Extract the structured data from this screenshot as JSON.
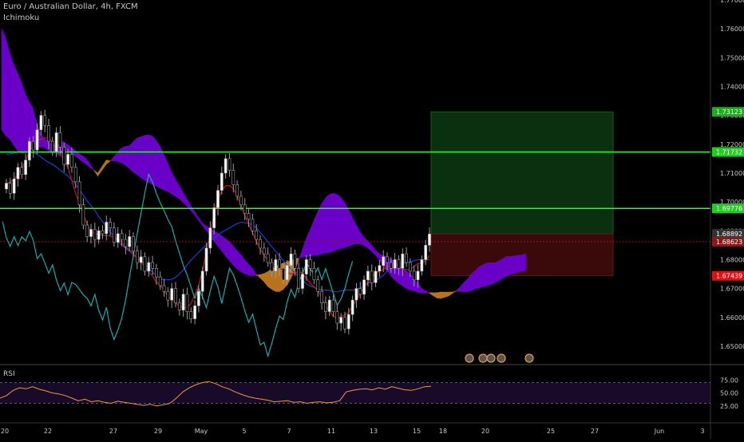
{
  "header": {
    "symbol_title": "Euro / Australian Dollar, 4h, FXCM",
    "indicator": "Ichimoku"
  },
  "rsi_panel": {
    "label": "RSI",
    "ticks": [
      "75.00",
      "50.00",
      "25.00"
    ],
    "upper": 70,
    "lower": 30
  },
  "colors": {
    "background": "#000000",
    "bull_candle": "#ffffff",
    "bear_candle": "#000000",
    "candle_outline": "#9c9c9c",
    "cloud_bull": "#6a00c8",
    "cloud_bear": "#b8731f",
    "tenkan": "#cc1010",
    "kijun": "#1a3fd1",
    "chikou": "#1ea8a8",
    "horizontal_level": "#22ff22",
    "current_price_line": "#8a1a1a",
    "rsi_line": "#e89a3c",
    "rsi_band": "#1a0a2a",
    "target_zone": "#0b3010",
    "stop_zone": "#3a0a0a",
    "axis_text": "#c8c8c8"
  },
  "chart_data": {
    "type": "candlestick",
    "title": "Euro / Australian Dollar, 4h, FXCM",
    "indicator": "Ichimoku",
    "ylim": [
      1.645,
      1.77
    ],
    "y_ticks": [
      "1.77000",
      "1.76000",
      "1.75000",
      "1.74000",
      "1.73000",
      "1.72000",
      "1.71000",
      "1.70000",
      "1.69000",
      "1.68000",
      "1.67000",
      "1.66000",
      "1.65000"
    ],
    "x_ticks": [
      "20",
      "22",
      "27",
      "29",
      "May",
      "5",
      "7",
      "11",
      "13",
      "15",
      "18",
      "20",
      "25",
      "27",
      "Jun",
      "3"
    ],
    "price_labels": [
      {
        "text": "1.73123",
        "value": 1.73123,
        "color": "#22aa22"
      },
      {
        "text": "1.71732",
        "value": 1.71732,
        "color": "#22cc22"
      },
      {
        "text": "1.69776",
        "value": 1.69776,
        "color": "#22cc22"
      },
      {
        "text": "1.68892",
        "value": 1.68892,
        "color": "#333333"
      },
      {
        "text": "1.68623",
        "value": 1.68623,
        "color": "#8a1a1a"
      },
      {
        "text": "1.67439",
        "value": 1.67439,
        "color": "#dd1111"
      }
    ],
    "horizontal_levels": [
      1.71732,
      1.69776
    ],
    "current_price": 1.68623,
    "position": {
      "entry": 1.68892,
      "target": 1.73123,
      "stop": 1.67439
    },
    "candles_close": [
      1.7065,
      1.703,
      1.708,
      1.712,
      1.7095,
      1.7145,
      1.721,
      1.718,
      1.725,
      1.73,
      1.7265,
      1.721,
      1.7175,
      1.724,
      1.719,
      1.713,
      1.7165,
      1.712,
      1.707,
      1.699,
      1.692,
      1.688,
      1.6905,
      1.687,
      1.69,
      1.689,
      1.693,
      1.691,
      1.686,
      1.689,
      1.687,
      1.6845,
      1.688,
      1.683,
      1.679,
      1.681,
      1.676,
      1.679,
      1.677,
      1.674,
      1.671,
      1.669,
      1.666,
      1.67,
      1.665,
      1.6625,
      1.668,
      1.662,
      1.6595,
      1.664,
      1.669,
      1.676,
      1.684,
      1.691,
      1.698,
      1.704,
      1.71,
      1.715,
      1.711,
      1.706,
      1.702,
      1.699,
      1.696,
      1.694,
      1.69,
      1.687,
      1.684,
      1.682,
      1.679,
      1.676,
      1.68,
      1.677,
      1.673,
      1.678,
      1.682,
      1.677,
      1.67,
      1.675,
      1.68,
      1.677,
      1.673,
      1.669,
      1.665,
      1.662,
      1.666,
      1.662,
      1.658,
      1.66,
      1.656,
      1.661,
      1.666,
      1.67,
      1.668,
      1.673,
      1.676,
      1.672,
      1.676,
      1.678,
      1.681,
      1.679,
      1.677,
      1.68,
      1.677,
      1.682,
      1.679,
      1.676,
      1.673,
      1.676,
      1.68,
      1.685,
      1.6889
    ],
    "rsi": [
      40,
      45,
      55,
      60,
      58,
      62,
      57,
      54,
      50,
      48,
      45,
      40,
      35,
      38,
      33,
      35,
      32,
      30,
      34,
      32,
      30,
      28,
      26,
      28,
      25,
      27,
      30,
      40,
      52,
      60,
      66,
      70,
      72,
      68,
      62,
      58,
      52,
      47,
      43,
      40,
      38,
      36,
      33,
      34,
      35,
      32,
      33,
      30,
      32,
      33,
      31,
      32,
      35,
      52,
      55,
      57,
      58,
      56,
      60,
      57,
      62,
      59,
      56,
      55,
      58,
      62,
      63
    ]
  }
}
